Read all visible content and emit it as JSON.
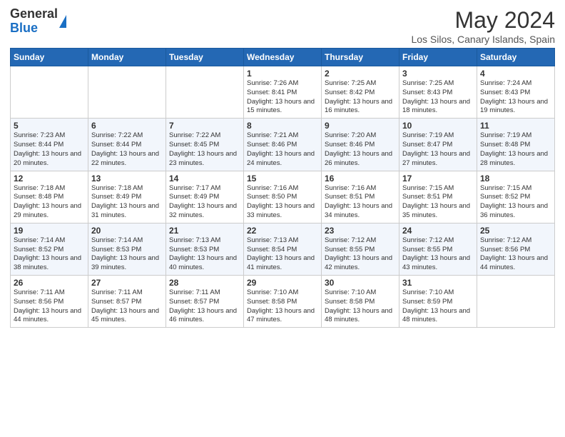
{
  "logo": {
    "general": "General",
    "blue": "Blue"
  },
  "header": {
    "title": "May 2024",
    "subtitle": "Los Silos, Canary Islands, Spain"
  },
  "weekdays": [
    "Sunday",
    "Monday",
    "Tuesday",
    "Wednesday",
    "Thursday",
    "Friday",
    "Saturday"
  ],
  "weeks": [
    [
      {
        "day": "",
        "info": ""
      },
      {
        "day": "",
        "info": ""
      },
      {
        "day": "",
        "info": ""
      },
      {
        "day": "1",
        "info": "Sunrise: 7:26 AM\nSunset: 8:41 PM\nDaylight: 13 hours and 15 minutes."
      },
      {
        "day": "2",
        "info": "Sunrise: 7:25 AM\nSunset: 8:42 PM\nDaylight: 13 hours and 16 minutes."
      },
      {
        "day": "3",
        "info": "Sunrise: 7:25 AM\nSunset: 8:43 PM\nDaylight: 13 hours and 18 minutes."
      },
      {
        "day": "4",
        "info": "Sunrise: 7:24 AM\nSunset: 8:43 PM\nDaylight: 13 hours and 19 minutes."
      }
    ],
    [
      {
        "day": "5",
        "info": "Sunrise: 7:23 AM\nSunset: 8:44 PM\nDaylight: 13 hours and 20 minutes."
      },
      {
        "day": "6",
        "info": "Sunrise: 7:22 AM\nSunset: 8:44 PM\nDaylight: 13 hours and 22 minutes."
      },
      {
        "day": "7",
        "info": "Sunrise: 7:22 AM\nSunset: 8:45 PM\nDaylight: 13 hours and 23 minutes."
      },
      {
        "day": "8",
        "info": "Sunrise: 7:21 AM\nSunset: 8:46 PM\nDaylight: 13 hours and 24 minutes."
      },
      {
        "day": "9",
        "info": "Sunrise: 7:20 AM\nSunset: 8:46 PM\nDaylight: 13 hours and 26 minutes."
      },
      {
        "day": "10",
        "info": "Sunrise: 7:19 AM\nSunset: 8:47 PM\nDaylight: 13 hours and 27 minutes."
      },
      {
        "day": "11",
        "info": "Sunrise: 7:19 AM\nSunset: 8:48 PM\nDaylight: 13 hours and 28 minutes."
      }
    ],
    [
      {
        "day": "12",
        "info": "Sunrise: 7:18 AM\nSunset: 8:48 PM\nDaylight: 13 hours and 29 minutes."
      },
      {
        "day": "13",
        "info": "Sunrise: 7:18 AM\nSunset: 8:49 PM\nDaylight: 13 hours and 31 minutes."
      },
      {
        "day": "14",
        "info": "Sunrise: 7:17 AM\nSunset: 8:49 PM\nDaylight: 13 hours and 32 minutes."
      },
      {
        "day": "15",
        "info": "Sunrise: 7:16 AM\nSunset: 8:50 PM\nDaylight: 13 hours and 33 minutes."
      },
      {
        "day": "16",
        "info": "Sunrise: 7:16 AM\nSunset: 8:51 PM\nDaylight: 13 hours and 34 minutes."
      },
      {
        "day": "17",
        "info": "Sunrise: 7:15 AM\nSunset: 8:51 PM\nDaylight: 13 hours and 35 minutes."
      },
      {
        "day": "18",
        "info": "Sunrise: 7:15 AM\nSunset: 8:52 PM\nDaylight: 13 hours and 36 minutes."
      }
    ],
    [
      {
        "day": "19",
        "info": "Sunrise: 7:14 AM\nSunset: 8:52 PM\nDaylight: 13 hours and 38 minutes."
      },
      {
        "day": "20",
        "info": "Sunrise: 7:14 AM\nSunset: 8:53 PM\nDaylight: 13 hours and 39 minutes."
      },
      {
        "day": "21",
        "info": "Sunrise: 7:13 AM\nSunset: 8:53 PM\nDaylight: 13 hours and 40 minutes."
      },
      {
        "day": "22",
        "info": "Sunrise: 7:13 AM\nSunset: 8:54 PM\nDaylight: 13 hours and 41 minutes."
      },
      {
        "day": "23",
        "info": "Sunrise: 7:12 AM\nSunset: 8:55 PM\nDaylight: 13 hours and 42 minutes."
      },
      {
        "day": "24",
        "info": "Sunrise: 7:12 AM\nSunset: 8:55 PM\nDaylight: 13 hours and 43 minutes."
      },
      {
        "day": "25",
        "info": "Sunrise: 7:12 AM\nSunset: 8:56 PM\nDaylight: 13 hours and 44 minutes."
      }
    ],
    [
      {
        "day": "26",
        "info": "Sunrise: 7:11 AM\nSunset: 8:56 PM\nDaylight: 13 hours and 44 minutes."
      },
      {
        "day": "27",
        "info": "Sunrise: 7:11 AM\nSunset: 8:57 PM\nDaylight: 13 hours and 45 minutes."
      },
      {
        "day": "28",
        "info": "Sunrise: 7:11 AM\nSunset: 8:57 PM\nDaylight: 13 hours and 46 minutes."
      },
      {
        "day": "29",
        "info": "Sunrise: 7:10 AM\nSunset: 8:58 PM\nDaylight: 13 hours and 47 minutes."
      },
      {
        "day": "30",
        "info": "Sunrise: 7:10 AM\nSunset: 8:58 PM\nDaylight: 13 hours and 48 minutes."
      },
      {
        "day": "31",
        "info": "Sunrise: 7:10 AM\nSunset: 8:59 PM\nDaylight: 13 hours and 48 minutes."
      },
      {
        "day": "",
        "info": ""
      }
    ]
  ]
}
